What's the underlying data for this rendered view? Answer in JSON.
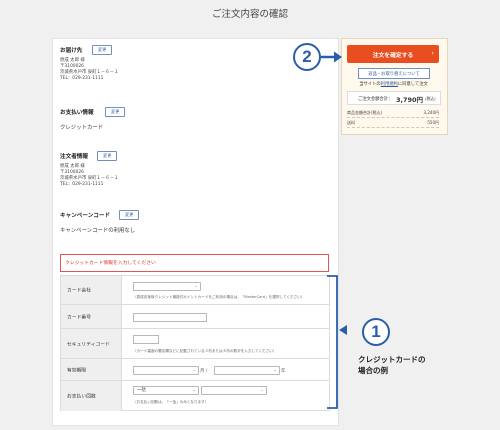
{
  "page": {
    "title": "ご注文内容の確認"
  },
  "delivery": {
    "label": "お届け先",
    "edit": "変更",
    "lines": [
      "原成 太郎 様",
      "〒3100026",
      "茨城県水戸市 泉町１－６－１",
      "TEL：029-231-1111"
    ]
  },
  "payment": {
    "label": "お支払い情報",
    "edit": "変更",
    "value": "クレジットカード"
  },
  "orderer": {
    "label": "注文者情報",
    "edit": "変更",
    "lines": [
      "原成 太郎 様",
      "〒3100026",
      "茨城県水戸市 泉町１－６－１",
      "TEL：029-231-1111"
    ]
  },
  "campaign": {
    "label": "キャンペーンコード",
    "edit": "変更",
    "value": "キャンペーンコードの利用なし"
  },
  "card_form": {
    "error": "クレジットカード情報を入力してください",
    "rows": {
      "company": {
        "label": "カード会社",
        "hint": "（原成克後後クレジット機能付ポイントカードをご利用の場合は、「MasterCard」を選択してください）"
      },
      "number": {
        "label": "カード番号"
      },
      "security": {
        "label": "セキュリティコード",
        "hint": "（カード裏面の署名欄などに記載されている３桁または４桁の数字を入力してください）"
      },
      "expiry": {
        "label": "有効期限",
        "month_suffix": "月 /",
        "year_suffix": "年"
      },
      "installments": {
        "label": "お支払い回数",
        "selected": "一括",
        "hint": "（お支払い回数は、「一括」のみとなります）"
      }
    }
  },
  "summary": {
    "confirm_button": "注文を確定する",
    "notice_button": "返品・お取り替えについて",
    "agree_prefix": "当サイトの",
    "agree_link": "利用規約",
    "agree_suffix": "に同意して注文",
    "total_label": "ご注文金額合計：",
    "total_value": "3,790円",
    "total_tax": "(税込)",
    "items_label": "商品金額合計(税込)",
    "items_value": "3,240円",
    "shipping_label": "送料",
    "shipping_value": "550円"
  },
  "annotations": {
    "step1": "1",
    "step2": "2",
    "caption_line1": "クレジットカードの",
    "caption_line2": "場合の例"
  },
  "colors": {
    "accent_orange": "#e84e1f",
    "annotation_blue": "#2a5fa8",
    "error_red": "#e35555"
  }
}
